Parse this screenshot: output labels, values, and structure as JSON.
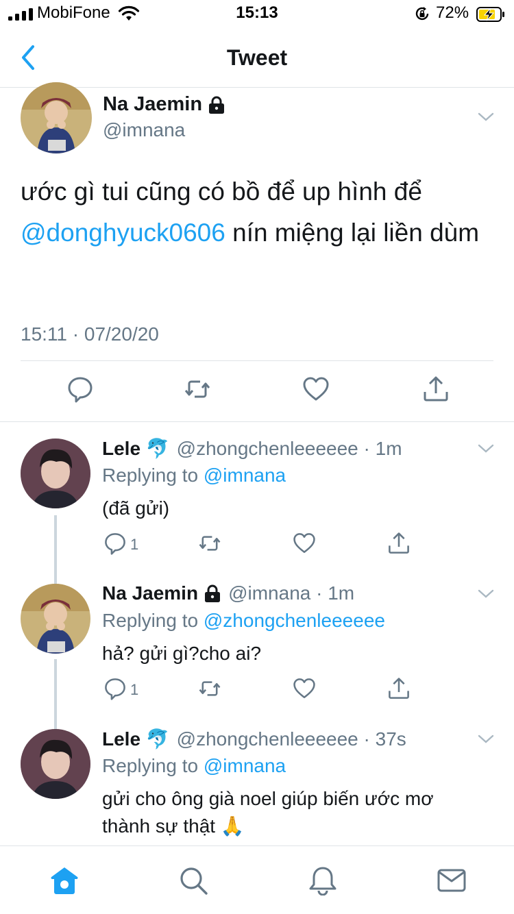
{
  "status": {
    "carrier": "MobiFone",
    "time": "15:13",
    "battery_pct": "72%"
  },
  "nav": {
    "title": "Tweet"
  },
  "main_tweet": {
    "name": "Na Jaemin",
    "handle": "@imnana",
    "text_before": "ước gì tui cũng có bồ để up hình để ",
    "mention": "@donghyuck0606",
    "text_after": " nín miệng lại liền dùm",
    "timestamp": "15:11 · 07/20/20"
  },
  "replies": [
    {
      "name": "Lele 🐬",
      "meta": "@zhongchenleeeeee · 1m",
      "replying_label": "Replying to",
      "replying_to": "@imnana",
      "text": "(đã gửi)",
      "reply_count": "1"
    },
    {
      "name": "Na Jaemin",
      "meta": "@imnana · 1m",
      "replying_label": "Replying to",
      "replying_to": "@zhongchenleeeeee",
      "text": "hả? gửi gì?cho ai?",
      "reply_count": "1"
    },
    {
      "name": "Lele 🐬",
      "meta": "@zhongchenleeeeee · 37s",
      "replying_label": "Replying to",
      "replying_to": "@imnana",
      "text": "gửi cho ông già noel giúp biến ước mơ thành sự thật 🙏"
    }
  ],
  "tabs": [
    "home-icon",
    "search-icon",
    "notifications-icon",
    "messages-icon"
  ],
  "colors": {
    "accent": "#1da1f2",
    "secondary_text": "#657786",
    "divider": "#dfe3e7",
    "icon_gray": "#657786"
  }
}
